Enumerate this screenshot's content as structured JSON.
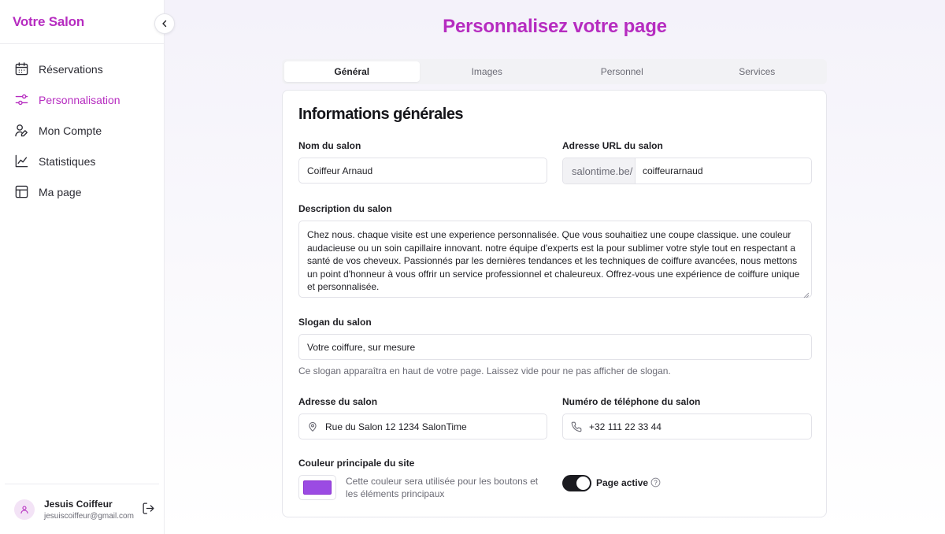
{
  "sidebar": {
    "brand": "Votre Salon",
    "items": [
      {
        "label": "Réservations",
        "icon": "calendar-icon",
        "active": false
      },
      {
        "label": "Personnalisation",
        "icon": "sliders-icon",
        "active": true
      },
      {
        "label": "Mon Compte",
        "icon": "user-edit-icon",
        "active": false
      },
      {
        "label": "Statistiques",
        "icon": "chart-line-icon",
        "active": false
      },
      {
        "label": "Ma page",
        "icon": "layout-icon",
        "active": false
      }
    ],
    "user": {
      "name": "Jesuis Coiffeur",
      "email": "jesuiscoiffeur@gmail.com"
    }
  },
  "page": {
    "title": "Personnalisez votre page"
  },
  "tabs": [
    {
      "label": "Général",
      "active": true
    },
    {
      "label": "Images",
      "active": false
    },
    {
      "label": "Personnel",
      "active": false
    },
    {
      "label": "Services",
      "active": false
    }
  ],
  "form": {
    "section_title": "Informations générales",
    "salon_name": {
      "label": "Nom du salon",
      "value": "Coiffeur Arnaud"
    },
    "salon_url": {
      "label": "Adresse URL du salon",
      "prefix": "salontime.be/",
      "value": "coiffeurarnaud"
    },
    "description": {
      "label": "Description du salon",
      "value": "Chez nous. chaque visite est une experience personnalisée. Que vous souhaitiez une coupe classique. une couleur audacieuse ou un soin capillaire innovant. notre équipe d'experts est la pour sublimer votre style tout en respectant a santé de vos cheveux. Passionnés par les dernières tendances et les techniques de coiffure avancées, nous mettons un point d'honneur à vous offrir un service professionnel et chaleureux. Offrez-vous une expérience de coiffure unique et personnalisée."
    },
    "slogan": {
      "label": "Slogan du salon",
      "value": "Votre coiffure, sur mesure",
      "help": "Ce slogan apparaîtra en haut de votre page. Laissez vide pour ne pas afficher de slogan."
    },
    "address": {
      "label": "Adresse du salon",
      "value": "Rue du Salon 12 1234 SalonTime"
    },
    "phone": {
      "label": "Numéro de téléphone du salon",
      "value": "+32 111 22 33 44"
    },
    "color": {
      "label": "Couleur principale du site",
      "value": "#9b4be3",
      "help": "Cette couleur sera utilisée pour les boutons et les éléments principaux"
    },
    "page_active": {
      "label": "Page active",
      "on": true
    }
  },
  "theme": {
    "accent": "#b62cc0",
    "toggle_on": "#1b1b20"
  }
}
